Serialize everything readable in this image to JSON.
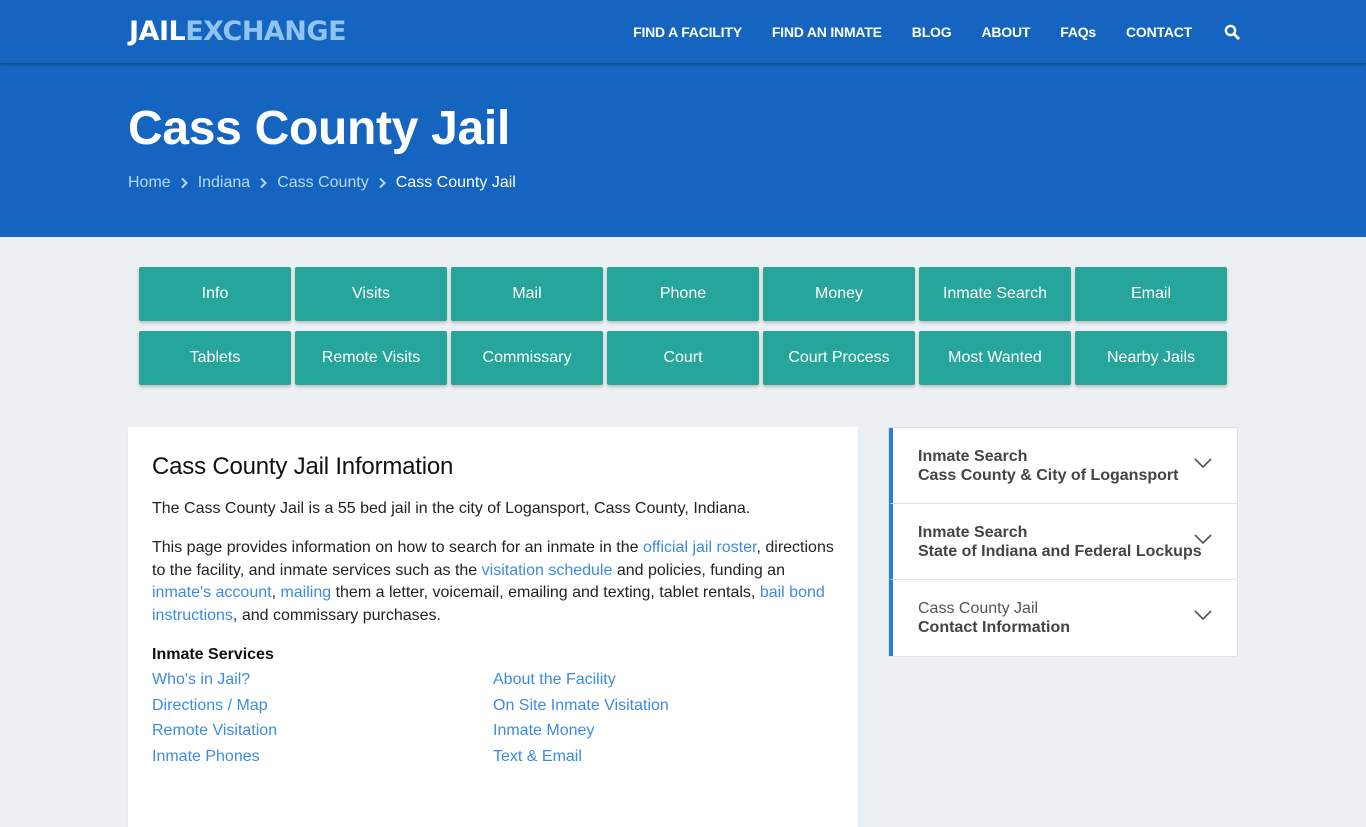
{
  "header": {
    "logo": {
      "part1": "JAIL",
      "part2": "EXCHANGE"
    },
    "nav": [
      {
        "label": "FIND A FACILITY"
      },
      {
        "label": "FIND AN INMATE"
      },
      {
        "label": "BLOG"
      },
      {
        "label": "ABOUT"
      },
      {
        "label": "FAQs"
      },
      {
        "label": "CONTACT"
      }
    ],
    "search_icon": "search-icon"
  },
  "hero": {
    "title": "Cass County Jail",
    "breadcrumbs": [
      {
        "label": "Home"
      },
      {
        "label": "Indiana"
      },
      {
        "label": "Cass County"
      },
      {
        "label": "Cass County Jail"
      }
    ]
  },
  "service_buttons": [
    {
      "label": "Info"
    },
    {
      "label": "Visits"
    },
    {
      "label": "Mail"
    },
    {
      "label": "Phone"
    },
    {
      "label": "Money"
    },
    {
      "label": "Inmate Search"
    },
    {
      "label": "Email"
    },
    {
      "label": "Tablets"
    },
    {
      "label": "Remote Visits"
    },
    {
      "label": "Commissary"
    },
    {
      "label": "Court"
    },
    {
      "label": "Court Process"
    },
    {
      "label": "Most Wanted"
    },
    {
      "label": "Nearby Jails"
    }
  ],
  "main": {
    "heading": "Cass County Jail Information",
    "intro": "The Cass County Jail is a 55 bed jail in the city of Logansport, Cass County, Indiana.",
    "para": {
      "t1": "This page provides information on how to search for an inmate in the ",
      "link1": "official jail roster",
      "t2": ", directions to the facility, and inmate services such as the ",
      "link2": "visitation schedule",
      "t3": " and policies, funding an ",
      "link3": "inmate's account",
      "t4": ", ",
      "link4": "mailing",
      "t5": " them a letter, voicemail, emailing and texting, tablet rentals, ",
      "link5": "bail bond instructions",
      "t6": ", and commissary purchases."
    },
    "services_heading": "Inmate Services",
    "services_links": [
      {
        "label": "Who's in Jail?"
      },
      {
        "label": "About the Facility"
      },
      {
        "label": "Directions / Map"
      },
      {
        "label": "On Site Inmate Visitation"
      },
      {
        "label": "Remote Visitation"
      },
      {
        "label": "Inmate Money"
      },
      {
        "label": "Inmate Phones"
      },
      {
        "label": "Text & Email"
      }
    ]
  },
  "sidebar": {
    "accordions": [
      {
        "line1": "Inmate Search",
        "line2": "Cass County & City of Logansport"
      },
      {
        "line1": "Inmate Search",
        "line2": "State of Indiana and Federal Lockups"
      },
      {
        "line1": "Cass County Jail",
        "line2": "Contact Information"
      }
    ]
  },
  "colors": {
    "brand_blue": "#1565c0",
    "logo_accent": "#8fc3f2",
    "button_teal": "#26a69a",
    "link_blue": "#3d8be0",
    "accordion_accent": "#2a7fd4",
    "page_bg": "#edf0f3"
  }
}
